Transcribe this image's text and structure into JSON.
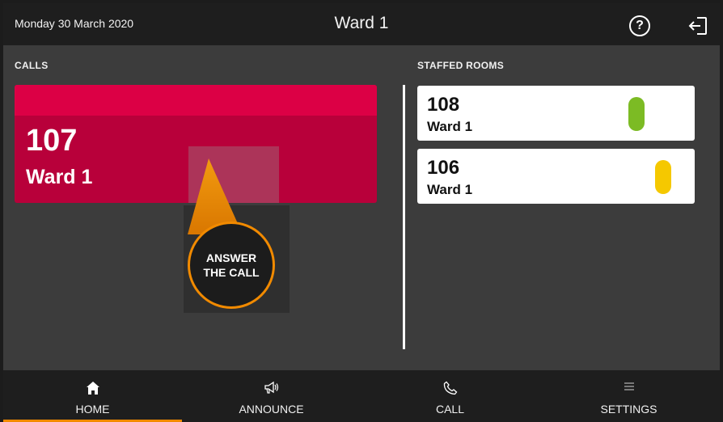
{
  "header": {
    "date": "Monday 30 March 2020",
    "title": "Ward 1",
    "help_icon": "?",
    "logout_icon": "logout-icon"
  },
  "calls": {
    "heading": "CALLS",
    "active_call": {
      "room": "107",
      "ward": "Ward 1",
      "color": "#dc0045"
    }
  },
  "tooltip": {
    "line1": "ANSWER",
    "line2": "THE CALL",
    "accent": "#f18a00"
  },
  "staffed": {
    "heading": "STAFFED ROOMS",
    "rooms": [
      {
        "number": "108",
        "ward": "Ward 1",
        "status_color": "#7cbb24"
      },
      {
        "number": "106",
        "ward": "Ward 1",
        "status_color": "#f5c800"
      }
    ]
  },
  "nav": {
    "active": "home",
    "items": [
      {
        "label": "HOME",
        "icon": "home-icon"
      },
      {
        "label": "ANNOUNCE",
        "icon": "megaphone-icon"
      },
      {
        "label": "CALL",
        "icon": "phone-icon"
      },
      {
        "label": "SETTINGS",
        "icon": "menu-icon"
      }
    ]
  }
}
